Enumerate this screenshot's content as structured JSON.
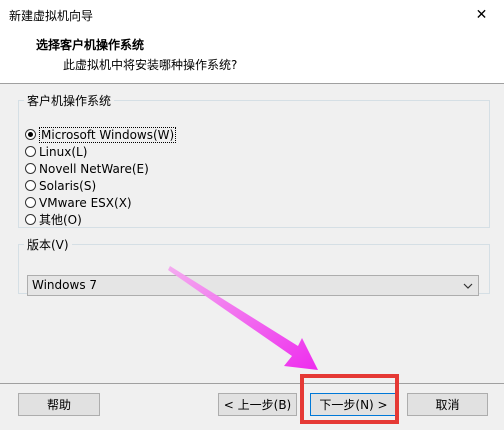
{
  "window": {
    "title": "新建虚拟机向导",
    "close_symbol": "✕"
  },
  "header": {
    "title": "选择客户机操作系统",
    "subtitle": "此虚拟机中将安装哪种操作系统?"
  },
  "os_group": {
    "legend": "客户机操作系统",
    "options": [
      {
        "label": "Microsoft Windows(W)",
        "checked": true
      },
      {
        "label": "Linux(L)",
        "checked": false
      },
      {
        "label": "Novell NetWare(E)",
        "checked": false
      },
      {
        "label": "Solaris(S)",
        "checked": false
      },
      {
        "label": "VMware ESX(X)",
        "checked": false
      },
      {
        "label": "其他(O)",
        "checked": false
      }
    ]
  },
  "version_group": {
    "legend": "版本(V)",
    "selected": "Windows 7"
  },
  "buttons": {
    "help": "帮助",
    "back": "< 上一步(B)",
    "next": "下一步(N) >",
    "cancel": "取消"
  },
  "annotation": {
    "arrow_color": "#ee22ee",
    "box_color": "#e53935"
  }
}
